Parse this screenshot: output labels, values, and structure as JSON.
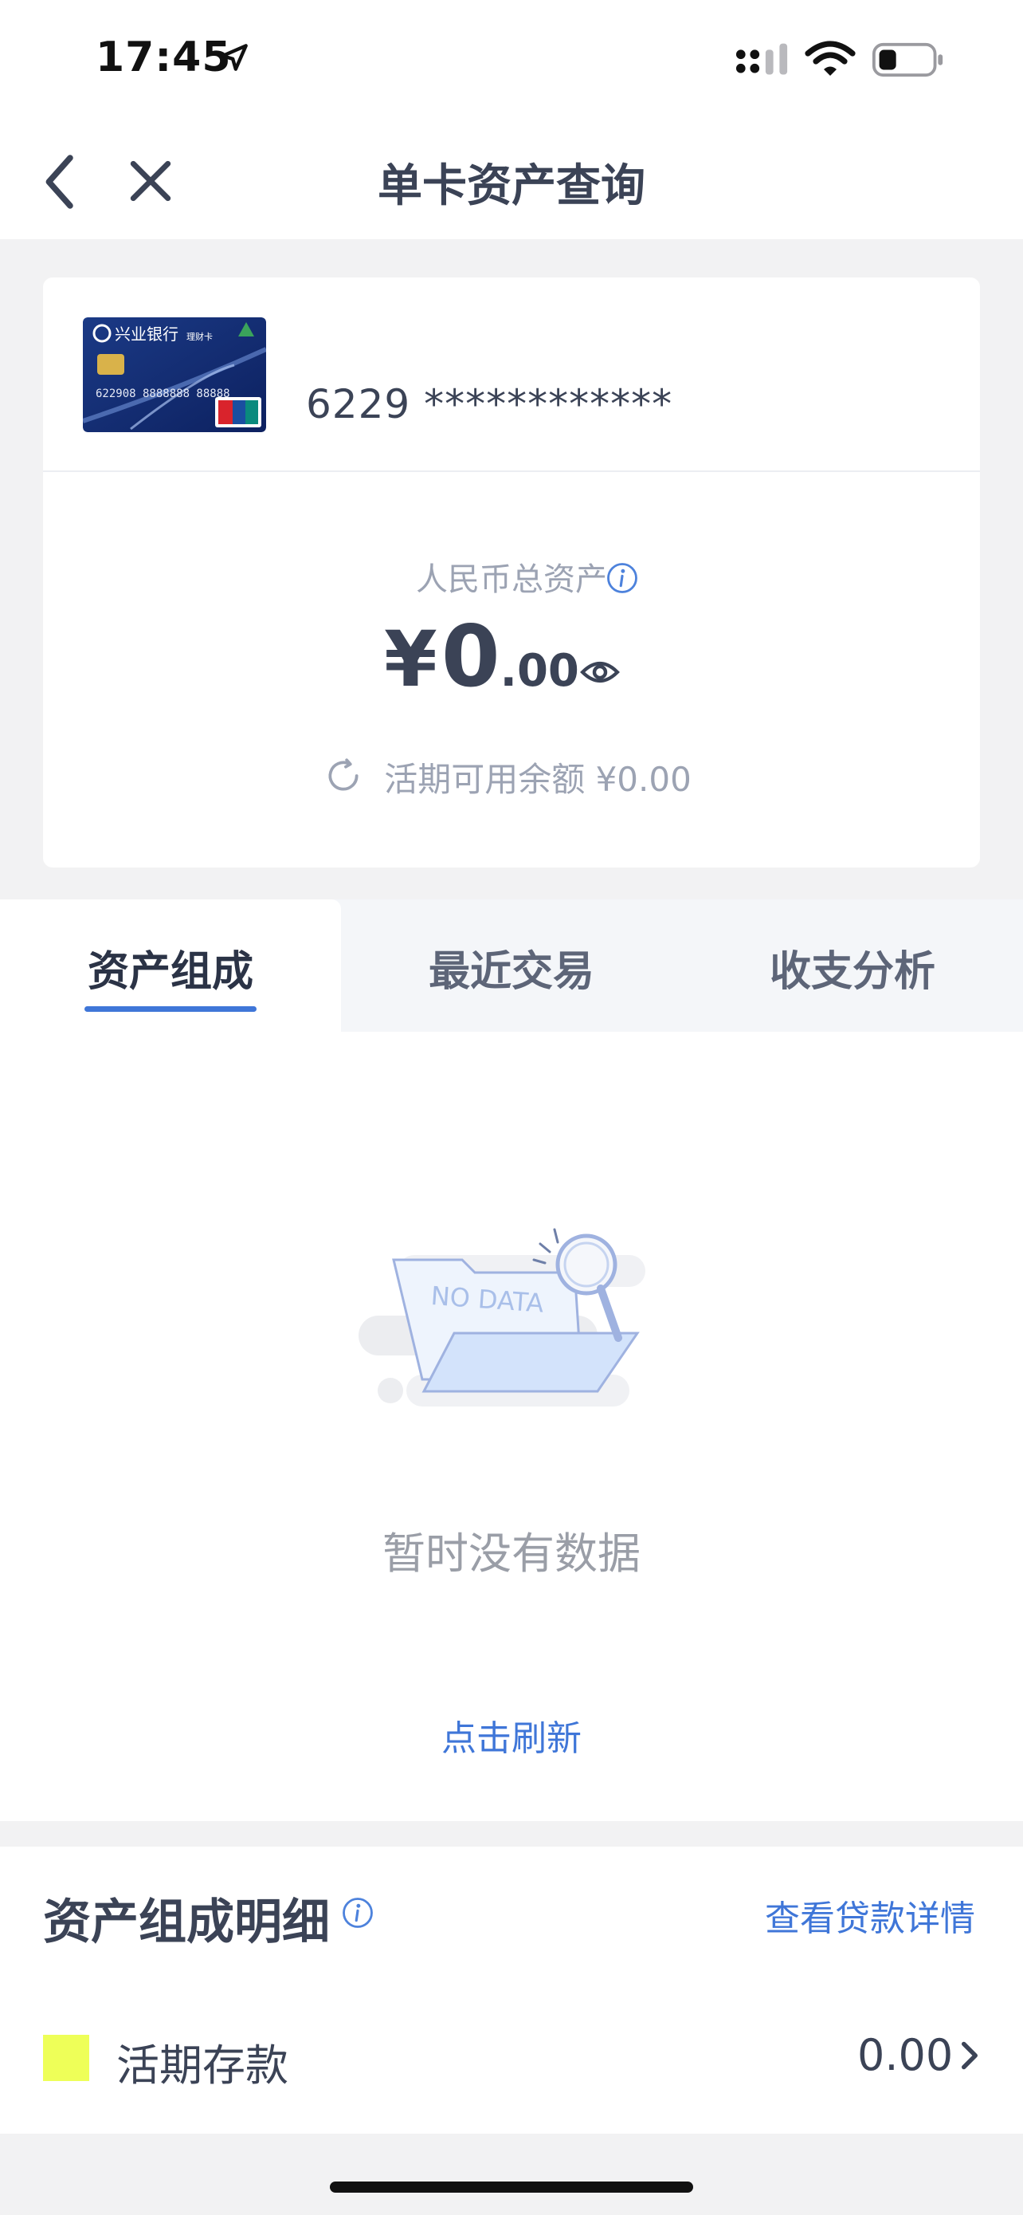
{
  "status_bar": {
    "time": "17:45"
  },
  "nav": {
    "title": "单卡资产查询"
  },
  "card": {
    "number": "6229 ************",
    "bank_name": "兴业银行",
    "card_type": "理财卡",
    "card_print": "622908 8888888 88888"
  },
  "summary": {
    "total_label": "人民币总资产",
    "currency_symbol": "¥",
    "amount_int": "0",
    "amount_dec": ".00",
    "balance_label": "活期可用余额",
    "balance_value": "¥0.00"
  },
  "tabs": [
    {
      "label": "资产组成",
      "active": true
    },
    {
      "label": "最近交易",
      "active": false
    },
    {
      "label": "收支分析",
      "active": false
    }
  ],
  "empty_state": {
    "illustration_text": "NO DATA",
    "message": "暂时没有数据",
    "refresh_label": "点击刷新"
  },
  "details": {
    "title": "资产组成明细",
    "loan_link": "查看贷款详情",
    "items": [
      {
        "label": "活期存款",
        "value": "0.00",
        "color": "#eeff58"
      }
    ]
  },
  "colors": {
    "accent": "#3f76d8",
    "text": "#3b4356",
    "muted": "#9ca3b3"
  }
}
